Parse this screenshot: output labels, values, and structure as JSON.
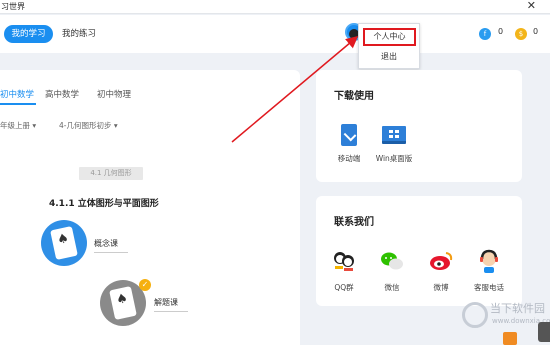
{
  "window": {
    "title": "习世界",
    "close_glyph": "✕"
  },
  "topnav": {
    "tabs": [
      {
        "label": "我的学习",
        "active": true
      },
      {
        "label": "我的练习",
        "active": false
      }
    ],
    "coins": [
      {
        "icon": "blue-coin-icon",
        "value": "0"
      },
      {
        "icon": "gold-coin-icon",
        "value": "0"
      }
    ]
  },
  "dropdown": {
    "items": [
      {
        "label": "个人中心",
        "highlighted": true
      },
      {
        "label": "退出",
        "highlighted": false
      }
    ]
  },
  "left_panel": {
    "subject_tabs": [
      {
        "label": "初中数学",
        "active": true
      },
      {
        "label": "高中数学",
        "active": false
      },
      {
        "label": "初中物理",
        "active": false
      }
    ],
    "filters": [
      "年级上册 ▾",
      "4-几何图形初步 ▾"
    ],
    "section_tag": "4.1 几何图形",
    "section_title": "4.1.1 立体图形与平面图形",
    "courses": [
      {
        "label": "概念课",
        "icon": "spade-card-icon",
        "color": "#2f8fe6"
      },
      {
        "label": "解题课",
        "icon": "spade-card-icon",
        "color": "#8a8a8a",
        "badge": "✓"
      }
    ]
  },
  "download_card": {
    "title": "下载使用",
    "items": [
      {
        "label": "移动端",
        "icon": "mobile-download-icon"
      },
      {
        "label": "Win桌面版",
        "icon": "windows-desktop-icon"
      }
    ]
  },
  "contact_card": {
    "title": "联系我们",
    "items": [
      {
        "label": "QQ群",
        "icon": "qq-group-icon"
      },
      {
        "label": "微信",
        "icon": "wechat-icon"
      },
      {
        "label": "微博",
        "icon": "weibo-icon"
      },
      {
        "label": "客服电话",
        "icon": "customer-service-icon"
      }
    ]
  },
  "watermark": {
    "text": "当下软件园",
    "url": "www.downxia.com"
  },
  "colors": {
    "accent": "#1a8ef0",
    "highlight_border": "#e0191f",
    "arrow": "#e0191f",
    "background": "#eef1f6"
  }
}
